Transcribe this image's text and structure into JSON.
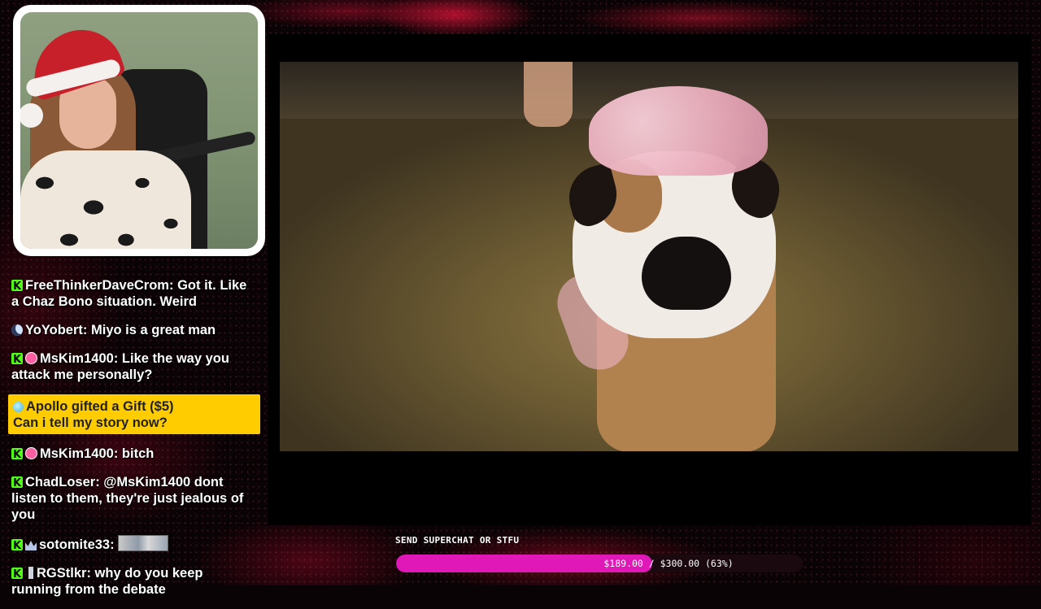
{
  "chat": {
    "messages": [
      {
        "user": "FreeThinkerDaveCrom",
        "text": "Got it. Like a Chaz Bono situation. Weird",
        "badges": [
          "kick-icon"
        ]
      },
      {
        "user": "YoYobert",
        "text": "Miyo is a great man",
        "badges": [
          "moon-icon"
        ]
      },
      {
        "user": "MsKim1400",
        "text": "Like the way you attack me personally?",
        "badges": [
          "kick-icon",
          "gifter-badge-icon"
        ]
      },
      {
        "user": "MsKim1400",
        "text": "bitch",
        "badges": [
          "kick-icon",
          "gifter-badge-icon"
        ]
      },
      {
        "user": "ChadLoser",
        "text": "@MsKim1400 dont listen to them, they're just jealous of you",
        "badges": [
          "kick-icon"
        ]
      },
      {
        "user": "sotomite33",
        "text": "",
        "badges": [
          "kick-icon",
          "crown-icon"
        ],
        "emote": "emote-image"
      },
      {
        "user": "RGStlkr",
        "text": "why do you keep running from the debate",
        "badges": [
          "kick-icon",
          "sword-icon"
        ]
      }
    ],
    "gift": {
      "line1": "Apollo gifted a Gift ($5)",
      "line2": "Can i tell my story now?",
      "color": "#ffcc00"
    }
  },
  "goal": {
    "title": "SEND SUPERCHAT OR STFU",
    "progress_text": "$189.00 / $300.00 (63%)",
    "percent": 63,
    "color": "#e018b8"
  },
  "colors": {
    "kick_badge": "#53fc18",
    "background": "#0a0305"
  }
}
